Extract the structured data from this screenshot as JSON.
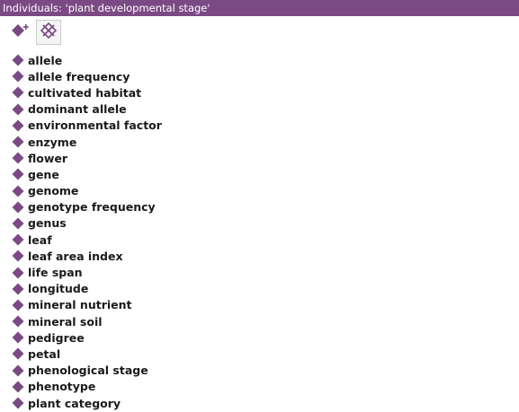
{
  "window": {
    "title": "Individuals: 'plant developmental stage'"
  },
  "toolbar": {
    "add_individual_icon": "add-individual-icon",
    "delete_individual_icon": "delete-individual-icon"
  },
  "colors": {
    "title_bar": "#7b4a84",
    "individual_marker": "#7b4a84"
  },
  "individuals": [
    {
      "label": "allele"
    },
    {
      "label": "allele frequency"
    },
    {
      "label": "cultivated habitat"
    },
    {
      "label": "dominant allele"
    },
    {
      "label": "environmental factor"
    },
    {
      "label": "enzyme"
    },
    {
      "label": "flower"
    },
    {
      "label": "gene"
    },
    {
      "label": "genome"
    },
    {
      "label": "genotype frequency"
    },
    {
      "label": "genus"
    },
    {
      "label": "leaf"
    },
    {
      "label": "leaf area index"
    },
    {
      "label": "life span"
    },
    {
      "label": "longitude"
    },
    {
      "label": "mineral nutrient"
    },
    {
      "label": "mineral soil"
    },
    {
      "label": "pedigree"
    },
    {
      "label": "petal"
    },
    {
      "label": "phenological stage"
    },
    {
      "label": "phenotype"
    },
    {
      "label": "plant category"
    }
  ]
}
